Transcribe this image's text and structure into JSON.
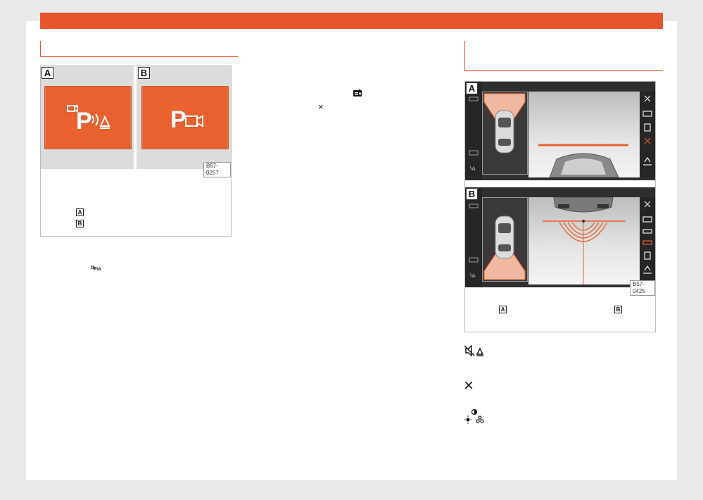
{
  "figure1": {
    "label_a": "A",
    "label_b": "B",
    "code": "B57-0257",
    "icon_a": "park-assist-camera-sensor-icon",
    "icon_b": "park-camera-icon",
    "caption_ref_a": "A",
    "caption_ref_b": "B"
  },
  "figure2": {
    "label_a": "A",
    "label_b": "B",
    "code": "B57-0425",
    "caption_ref_a": "A",
    "caption_ref_b": "B"
  },
  "left_text": {
    "inline_icon": "park-sensor-icon"
  },
  "middle_text": {
    "icon_camera": "camera-screen-icon",
    "icon_close": "×"
  },
  "right_icons": {
    "mute_icon": "mute-sound-warning-icon",
    "close_icon": "×",
    "brightness_icon": "brightness-contrast-color-icon"
  },
  "colors": {
    "accent": "#e8552a",
    "button_orange": "#e8612f"
  }
}
